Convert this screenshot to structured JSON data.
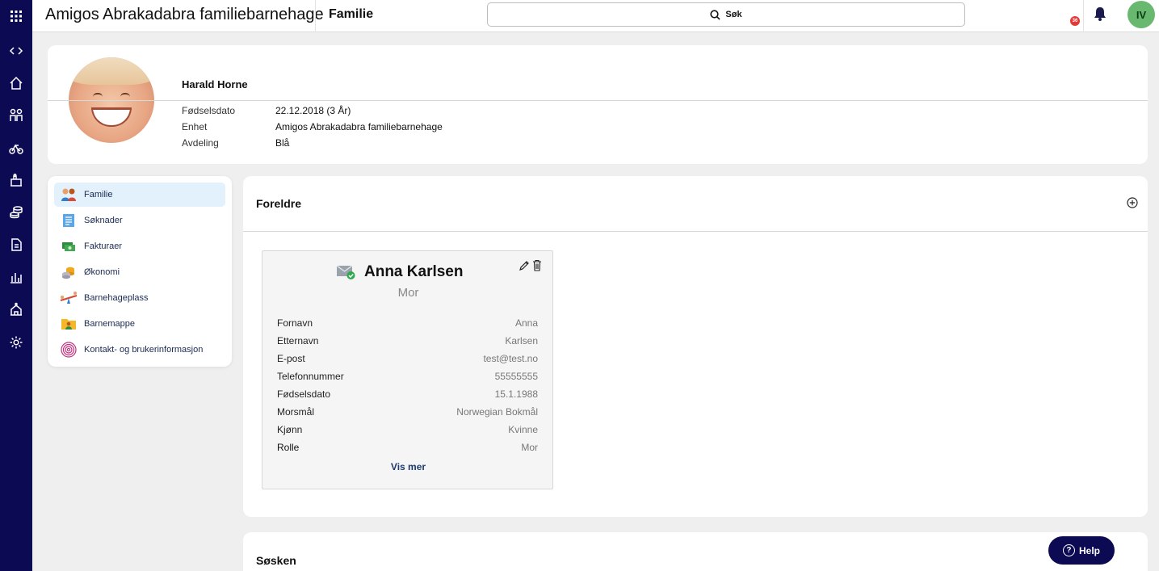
{
  "topbar": {
    "org_name": "Amigos Abrakadabra familiebarnehage",
    "page_name": "Familie",
    "search_label": "Søk",
    "notification_count": "36",
    "user_initials": "IV"
  },
  "rail": {
    "icons": [
      "apps-grid-icon",
      "collapse-toggle-icon",
      "home-icon",
      "children-icon",
      "cycle-icon",
      "daycare-icon",
      "coins-icon",
      "document-icon",
      "chart-icon",
      "institution-icon",
      "gear-icon"
    ]
  },
  "child": {
    "name": "Harald Horne",
    "fields": [
      {
        "label": "Fødselsdato",
        "value": "22.12.2018 (3 År)"
      },
      {
        "label": "Enhet",
        "value": "Amigos Abrakadabra familiebarnehage"
      },
      {
        "label": "Avdeling",
        "value": "Blå"
      }
    ]
  },
  "side_menu": {
    "items": [
      {
        "label": "Familie",
        "icon": "family-icon",
        "active": true
      },
      {
        "label": "Søknader",
        "icon": "application-form-icon",
        "active": false
      },
      {
        "label": "Fakturaer",
        "icon": "invoice-money-icon",
        "active": false
      },
      {
        "label": "Økonomi",
        "icon": "coin-stack-icon",
        "active": false
      },
      {
        "label": "Barnehageplass",
        "icon": "seesaw-icon",
        "active": false
      },
      {
        "label": "Barnemappe",
        "icon": "child-folder-icon",
        "active": false
      },
      {
        "label": "Kontakt- og brukerinformasjon",
        "icon": "fingerprint-icon",
        "active": false
      }
    ]
  },
  "parents": {
    "title": "Foreldre",
    "card": {
      "name": "Anna Karlsen",
      "role": "Mor",
      "rows": [
        {
          "label": "Fornavn",
          "value": "Anna"
        },
        {
          "label": "Etternavn",
          "value": "Karlsen"
        },
        {
          "label": "E-post",
          "value": "test@test.no"
        },
        {
          "label": "Telefonnummer",
          "value": "55555555"
        },
        {
          "label": "Fødselsdato",
          "value": "15.1.1988"
        },
        {
          "label": "Morsmål",
          "value": "Norwegian Bokmål"
        },
        {
          "label": "Kjønn",
          "value": "Kvinne"
        },
        {
          "label": "Rolle",
          "value": "Mor"
        }
      ],
      "show_more": "Vis mer"
    }
  },
  "siblings": {
    "title": "Søsken"
  },
  "help": {
    "label": "Help"
  },
  "colors": {
    "rail": "#0b0a52",
    "active_menu": "#e2f1fc",
    "avatar": "#69b86f",
    "badge": "#e53935",
    "link": "#1c3a6e"
  }
}
